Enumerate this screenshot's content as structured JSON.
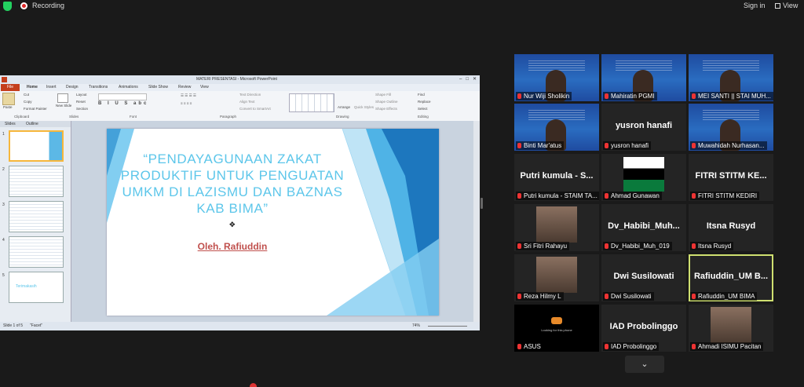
{
  "topbar": {
    "recording_label": "Recording",
    "signin_label": "Sign in",
    "view_label": "View"
  },
  "ppt": {
    "title": "MATERI PRESENTASI - Microsoft PowerPoint",
    "tabs": [
      "File",
      "Home",
      "Insert",
      "Design",
      "Transitions",
      "Animations",
      "Slide Show",
      "Review",
      "View"
    ],
    "ribbon": {
      "paste": "Paste",
      "cut": "Cut",
      "copy": "Copy",
      "format_painter": "Format Painter",
      "new_slide": "New Slide",
      "layout": "Layout",
      "reset": "Reset",
      "section": "Section",
      "text_direction": "Text Direction",
      "align_text": "Align Text",
      "convert_smartart": "Convert to SmartArt",
      "arrange": "Arrange",
      "quick_styles": "Quick Styles",
      "shape_fill": "Shape Fill",
      "shape_outline": "Shape Outline",
      "shape_effects": "Shape Effects",
      "find": "Find",
      "replace": "Replace",
      "select": "Select",
      "groups": [
        "Clipboard",
        "Slides",
        "Font",
        "Paragraph",
        "Drawing",
        "Editing"
      ]
    },
    "panel_tabs": [
      "Slides",
      "Outline"
    ],
    "thumbnails": [
      "1",
      "2",
      "3",
      "4",
      "5"
    ],
    "thumb5_text": "Terimakasih",
    "slide": {
      "title_line1": "“PENDAYAGUNAAN ZAKAT",
      "title_line2": "PRODUKTIF UNTUK PENGUATAN",
      "title_line3": "UMKM DI LAZISMU DAN BAZNAS",
      "title_line4": "KAB BIMA”",
      "subtitle": "Oleh. Rafiuddin"
    },
    "status": {
      "slide_of": "Slide 1 of 5",
      "theme": "\"Facet\"",
      "zoom": "74%"
    }
  },
  "participants": [
    {
      "name": "Nur Wiji Sholikin",
      "kind": "video"
    },
    {
      "name": "Mahiratin PGMI",
      "kind": "video"
    },
    {
      "name": "MEI SANTI || STAI MUH...",
      "kind": "video"
    },
    {
      "name": "Binti Mar'atus",
      "kind": "video"
    },
    {
      "name": "yusron hanafi",
      "display": "yusron hanafi",
      "kind": "text"
    },
    {
      "name": "Muwahidah Nurhasan...",
      "kind": "video"
    },
    {
      "name": "Putri kumula - STAIM TA...",
      "display": "Putri kumula - S...",
      "kind": "text"
    },
    {
      "name": "Ahmad Gunawan",
      "kind": "avatar"
    },
    {
      "name": "FITRI STITM KEDIRI",
      "display": "FITRI STITM KE...",
      "kind": "text"
    },
    {
      "name": "Sri Fitri Rahayu",
      "kind": "photo"
    },
    {
      "name": "Dv_Habibi_Muh_019",
      "display": "Dv_Habibi_Muh...",
      "kind": "text"
    },
    {
      "name": "Itsna Rusyd",
      "display": "Itsna Rusyd",
      "kind": "text"
    },
    {
      "name": "Reza Hilmy L",
      "kind": "photo"
    },
    {
      "name": "Dwi Susilowati",
      "display": "Dwi Susilowati",
      "kind": "text"
    },
    {
      "name": "Rafiuddin_UM BIMA",
      "display": "Rafiuddin_UM B...",
      "kind": "text",
      "active": true
    },
    {
      "name": "ASUS",
      "kind": "loading",
      "caption": "Looking for this phone"
    },
    {
      "name": "IAD Probolinggo",
      "display": "IAD Probolinggo",
      "kind": "text"
    },
    {
      "name": "Ahmadi ISIMU Pacitan",
      "kind": "photo"
    }
  ],
  "more_icon": "chevron-down-icon",
  "colors": {
    "background": "#1a1a1a",
    "active_border": "#cfe070",
    "slide_title": "#5cc6ea",
    "slide_subtitle": "#c0504d",
    "record": "#e02828"
  }
}
